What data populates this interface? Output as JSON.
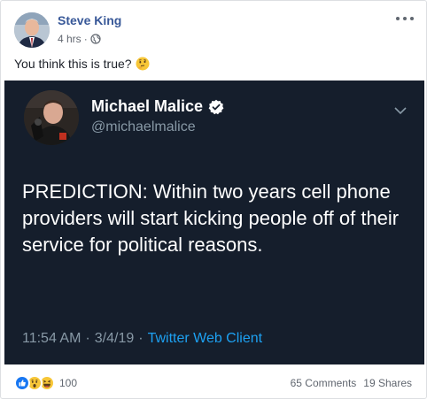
{
  "post": {
    "author": "Steve King",
    "time": "4 hrs",
    "separator": "·",
    "text": "You think this is true?"
  },
  "tweet": {
    "name": "Michael Malice",
    "handle": "@michaelmalice",
    "body": "PREDICTION: Within two years cell phone providers will start kicking people off of their service for political reasons.",
    "time": "11:54 AM",
    "date": "3/4/19",
    "sep": "·",
    "client": "Twitter Web Client"
  },
  "footer": {
    "reaction_count": "100",
    "comments": "65 Comments",
    "shares": "19 Shares"
  },
  "colors": {
    "link_blue": "#385898",
    "tweet_bg": "#151e2c",
    "twitter_blue": "#1da1f2",
    "muted": "#616770"
  },
  "icons": [
    "globe-icon",
    "thinking-face-emoji-icon",
    "verified-badge-icon",
    "chevron-down-icon",
    "more-options-icon",
    "like-reaction-icon",
    "wow-reaction-icon",
    "haha-reaction-icon"
  ]
}
